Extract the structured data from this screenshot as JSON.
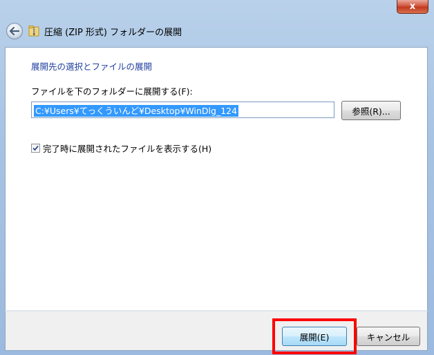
{
  "window": {
    "title": "圧縮 (ZIP 形式) フォルダーの展開",
    "close_glyph": "x"
  },
  "icons": {
    "back": "back-arrow-icon",
    "zip": "zip-folder-icon",
    "close": "close-icon",
    "check": "checkmark-icon"
  },
  "content": {
    "heading": "展開先の選択とファイルの展開",
    "extract_label": "ファイルを下のフォルダーに展開する(F):",
    "path_value": "C:¥Users¥てっくういんど¥Desktop¥WinDlg_124",
    "browse_label": "参照(R)...",
    "show_files_label": "完了時に展開されたファイルを表示する(H)",
    "show_files_checked": true
  },
  "footer": {
    "extract_label": "展開(E)",
    "cancel_label": "キャンセル"
  },
  "colors": {
    "heading": "#1f3e9f",
    "selection": "#3399ff",
    "highlight": "#ff0000",
    "chrome": "#a7c3e3"
  }
}
